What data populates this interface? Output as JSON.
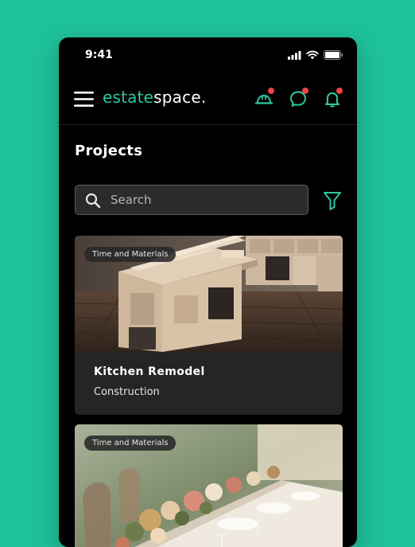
{
  "status_bar": {
    "time": "9:41"
  },
  "header": {
    "logo_part1": "estate",
    "logo_part2": "space."
  },
  "page": {
    "title": "Projects"
  },
  "search": {
    "placeholder": "Search",
    "value": ""
  },
  "projects": [
    {
      "badge": "Time and Materials",
      "title": "Kitchen Remodel",
      "category": "Construction"
    },
    {
      "badge": "Time and Materials"
    }
  ],
  "colors": {
    "background": "#1fc19a",
    "accent": "#2ec8a0",
    "notification_dot": "#ef4444",
    "phone": "#000000",
    "card": "#252525"
  },
  "icons": [
    "menu-icon",
    "hard-hat-icon",
    "chat-icon",
    "bell-icon",
    "search-icon",
    "filter-icon",
    "signal-icon",
    "wifi-icon",
    "battery-icon"
  ]
}
